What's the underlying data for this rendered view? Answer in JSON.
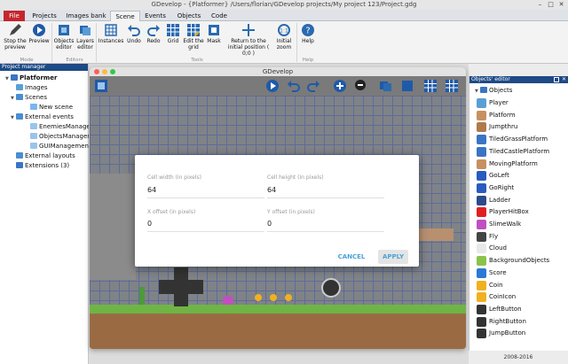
{
  "app": {
    "title": "GDevelop - {Platformer} /Users/florian/GDevelop projects/My project 123/Project.gdg"
  },
  "tabs": [
    {
      "label": "File"
    },
    {
      "label": "Projects"
    },
    {
      "label": "Images bank"
    },
    {
      "label": "Scene"
    },
    {
      "label": "Events"
    },
    {
      "label": "Objects"
    },
    {
      "label": "Code"
    }
  ],
  "ribbon": {
    "stop_preview": "Stop the preview",
    "preview": "Preview",
    "objects_editor": "Objects editor",
    "layers_editor": "Layers editor",
    "instances": "Instances",
    "undo": "Undo",
    "redo": "Redo",
    "grid": "Grid",
    "edit_grid": "Edit the grid",
    "mask": "Mask",
    "return_origin": "Return to the initial position ( 0;0 )",
    "initial_zoom": "Initial zoom",
    "help": "Help",
    "groups": {
      "mode": "Mode",
      "editors": "Editors",
      "tools": "Tools",
      "help": "Help"
    }
  },
  "project_manager": {
    "header": "Project manager",
    "items": [
      {
        "label": "Platformer"
      },
      {
        "label": "Images"
      },
      {
        "label": "Scenes"
      },
      {
        "label": "New scene"
      },
      {
        "label": "External events"
      },
      {
        "label": "EnemiesManager"
      },
      {
        "label": "ObjectsManagem"
      },
      {
        "label": "GUIManagement"
      },
      {
        "label": "External layouts"
      },
      {
        "label": "Extensions (3)"
      }
    ]
  },
  "scene_window": {
    "title": "GDevelop"
  },
  "dialog": {
    "cell_width_label": "Cell width (in pixels)",
    "cell_width_value": "64",
    "cell_height_label": "Cell height (in pixels)",
    "cell_height_value": "64",
    "x_offset_label": "X offset (in pixels)",
    "x_offset_value": "0",
    "y_offset_label": "Y offset (in pixels)",
    "y_offset_value": "0",
    "cancel": "CANCEL",
    "apply": "APPLY"
  },
  "objects_editor": {
    "header": "Objects' editor",
    "root": "Objects",
    "items": [
      {
        "label": "Player",
        "color": "#5a9fd4"
      },
      {
        "label": "Platform",
        "color": "#c89060"
      },
      {
        "label": "Jumpthru",
        "color": "#b07a4a"
      },
      {
        "label": "TiledGrassPlatform",
        "color": "#3a74c4"
      },
      {
        "label": "TiledCastlePlatform",
        "color": "#3a74c4"
      },
      {
        "label": "MovingPlatform",
        "color": "#c89060"
      },
      {
        "label": "GoLeft",
        "color": "#2a5bbf"
      },
      {
        "label": "GoRight",
        "color": "#2a5bbf"
      },
      {
        "label": "Ladder",
        "color": "#2b4b8a"
      },
      {
        "label": "PlayerHitBox",
        "color": "#e02020"
      },
      {
        "label": "SlimeWalk",
        "color": "#c050c0"
      },
      {
        "label": "Fly",
        "color": "#444444"
      },
      {
        "label": "Cloud",
        "color": "#e8e8e8"
      },
      {
        "label": "BackgroundObjects",
        "color": "#8bc34a"
      },
      {
        "label": "Score",
        "color": "#2a7ad4"
      },
      {
        "label": "Coin",
        "color": "#f0b020"
      },
      {
        "label": "CoinIcon",
        "color": "#f0b020"
      },
      {
        "label": "LeftButton",
        "color": "#333333"
      },
      {
        "label": "RightButton",
        "color": "#333333"
      },
      {
        "label": "JumpButton",
        "color": "#333333"
      }
    ]
  },
  "footer": {
    "text": "2008-2016"
  }
}
